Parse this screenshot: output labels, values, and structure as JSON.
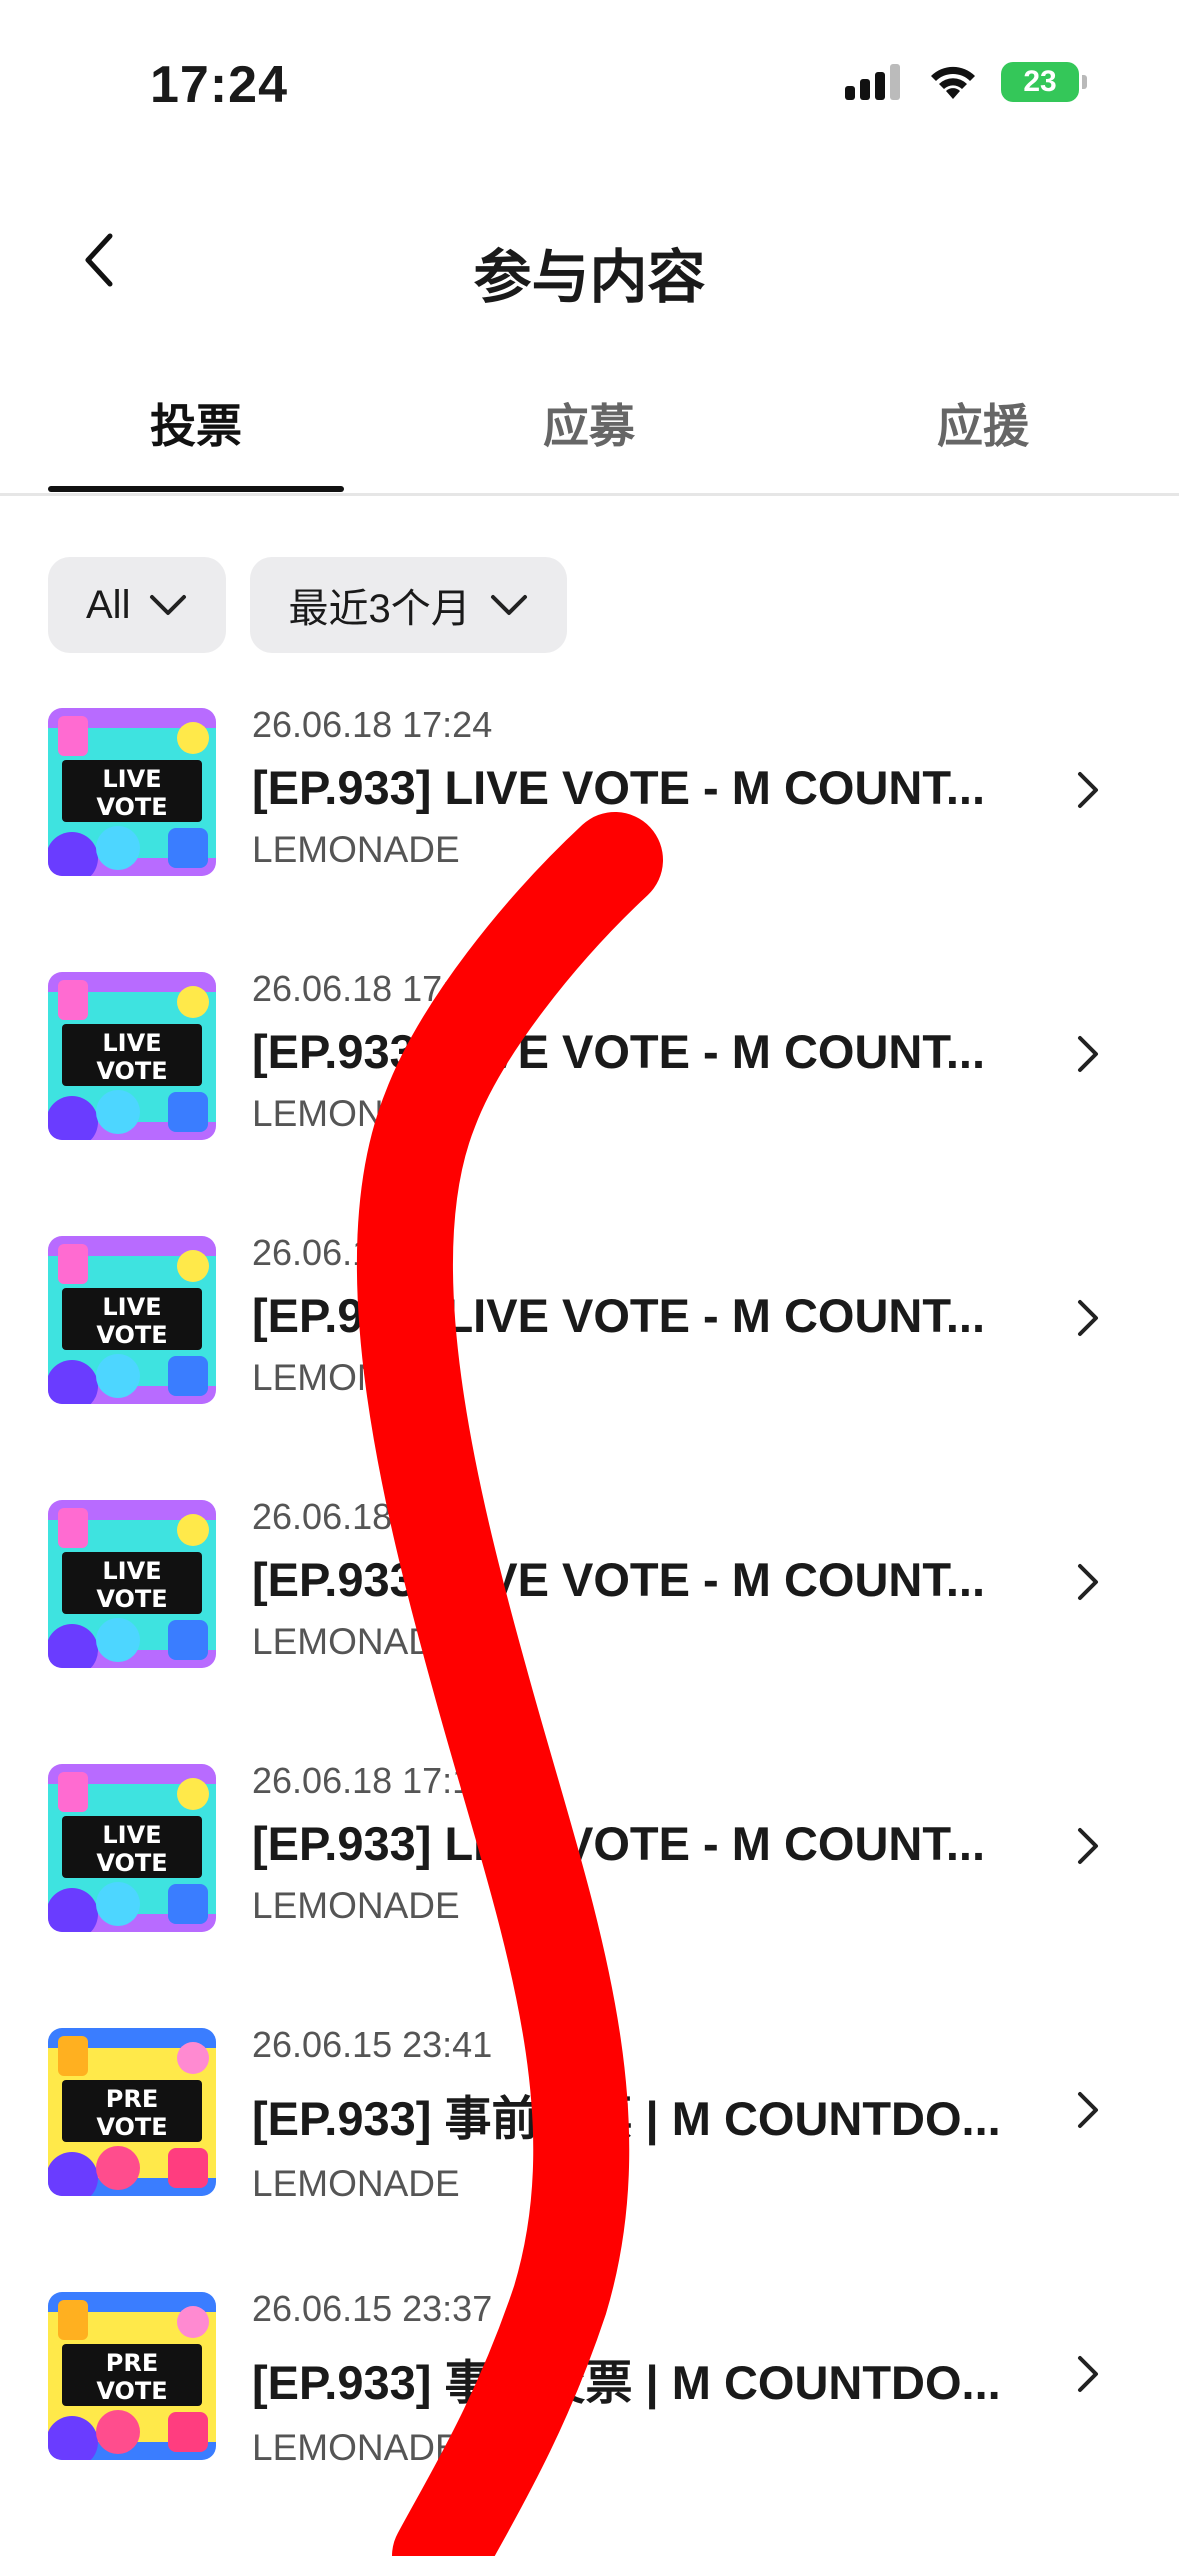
{
  "status_bar": {
    "time": "17:24",
    "battery": "23",
    "icons": [
      "signal-icon",
      "wifi-icon",
      "battery-icon"
    ]
  },
  "header": {
    "title": "参与内容",
    "back_icon": "chevron-left-icon"
  },
  "tabs": [
    {
      "label": "投票",
      "active": true
    },
    {
      "label": "应募",
      "active": false
    },
    {
      "label": "应援",
      "active": false
    }
  ],
  "filters": [
    {
      "label": "All"
    },
    {
      "label": "最近3个月"
    }
  ],
  "items": [
    {
      "date": "26.06.18 17:24",
      "title": "[EP.933] LIVE VOTE - M COUNT...",
      "artist": "LEMONADE",
      "badge": [
        "LIVE",
        "VOTE"
      ]
    },
    {
      "date": "26.06.18 17:2",
      "title": "[EP.933] LIVE VOTE - M COUNT...",
      "artist": "LEMONADE",
      "badge": [
        "LIVE",
        "VOTE"
      ]
    },
    {
      "date": "26.06.18",
      "title": "[EP.933] LIVE VOTE - M COUNT...",
      "artist": "LEMONADE",
      "badge": [
        "LIVE",
        "VOTE"
      ]
    },
    {
      "date": "26.06.18 17",
      "title": "[EP.933] LIVE VOTE - M COUNT...",
      "artist": "LEMONADE",
      "badge": [
        "LIVE",
        "VOTE"
      ]
    },
    {
      "date": "26.06.18 17:17",
      "title": "[EP.933] LIVE VOTE - M COUNT...",
      "artist": "LEMONADE",
      "badge": [
        "LIVE",
        "VOTE"
      ]
    },
    {
      "date": "26.06.15 23:41",
      "title": "[EP.933] 事前投票 | M COUNTDO...",
      "artist": "LEMONADE",
      "badge": [
        "PRE",
        "VOTE"
      ]
    },
    {
      "date": "26.06.15 23:37",
      "title": "[EP.933] 事前投票 | M COUNTDO...",
      "artist": "LEMONADE",
      "badge": [
        "PRE",
        "VOTE"
      ]
    }
  ],
  "colors": {
    "scribble": "#ff0000",
    "live_bg": "#3ee3e0",
    "pre_bg": "#ffe94a",
    "badge_text": "#ffffff"
  }
}
